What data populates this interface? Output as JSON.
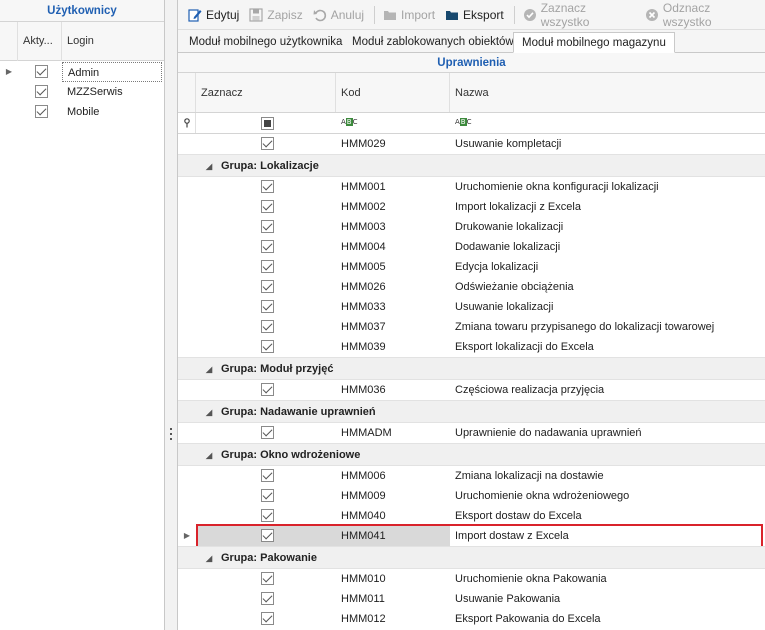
{
  "left_panel": {
    "title": "Użytkownicy",
    "columns": {
      "active": "Akty...",
      "login": "Login"
    },
    "users": [
      {
        "login": "Admin",
        "active": true,
        "focused": true
      },
      {
        "login": "MZZSerwis",
        "active": true
      },
      {
        "login": "Mobile",
        "active": true
      }
    ]
  },
  "toolbar": {
    "edit_label": "Edytuj",
    "save_label": "Zapisz",
    "cancel_label": "Anuluj",
    "import_label": "Import",
    "export_label": "Eksport",
    "select_all_label": "Zaznacz wszystko",
    "deselect_all_label": "Odznacz wszystko"
  },
  "tabs": [
    {
      "label": "Moduł mobilnego użytkownika",
      "active": false
    },
    {
      "label": "Moduł zablokowanych obiektów",
      "active": false
    },
    {
      "label": "Moduł mobilnego magazynu",
      "active": true
    }
  ],
  "grid": {
    "title": "Uprawnienia",
    "columns": {
      "select": "Zaznacz",
      "code": "Kod",
      "name": "Nazwa"
    },
    "filter_icon": "pin-icon",
    "sections": [
      {
        "group": null,
        "rows": [
          {
            "code": "HMM029",
            "name": "Usuwanie kompletacji"
          }
        ]
      },
      {
        "group": "Grupa: Lokalizacje",
        "rows": [
          {
            "code": "HMM001",
            "name": "Uruchomienie okna konfiguracji lokalizacji"
          },
          {
            "code": "HMM002",
            "name": "Import lokalizacji z Excela"
          },
          {
            "code": "HMM003",
            "name": "Drukowanie lokalizacji"
          },
          {
            "code": "HMM004",
            "name": "Dodawanie lokalizacji"
          },
          {
            "code": "HMM005",
            "name": "Edycja lokalizacji"
          },
          {
            "code": "HMM026",
            "name": "Odświeżanie obciążenia"
          },
          {
            "code": "HMM033",
            "name": "Usuwanie lokalizacji"
          },
          {
            "code": "HMM037",
            "name": "Zmiana towaru przypisanego do lokalizacji towarowej"
          },
          {
            "code": "HMM039",
            "name": "Eksport lokalizacji do Excela"
          }
        ]
      },
      {
        "group": "Grupa: Moduł przyjęć",
        "rows": [
          {
            "code": "HMM036",
            "name": "Częściowa realizacja przyjęcia"
          }
        ]
      },
      {
        "group": "Grupa: Nadawanie uprawnień",
        "rows": [
          {
            "code": "HMMADM",
            "name": "Uprawnienie do nadawania uprawnień"
          }
        ]
      },
      {
        "group": "Grupa: Okno wdrożeniowe",
        "rows": [
          {
            "code": "HMM006",
            "name": "Zmiana lokalizacji na dostawie"
          },
          {
            "code": "HMM009",
            "name": "Uruchomienie okna wdrożeniowego"
          },
          {
            "code": "HMM040",
            "name": "Eksport dostaw do Excela"
          },
          {
            "code": "HMM041",
            "name": "Import dostaw z Excela",
            "highlighted": true
          }
        ]
      },
      {
        "group": "Grupa: Pakowanie",
        "rows": [
          {
            "code": "HMM010",
            "name": "Uruchomienie okna Pakowania"
          },
          {
            "code": "HMM011",
            "name": "Usuwanie Pakowania"
          },
          {
            "code": "HMM012",
            "name": "Eksport Pakowania do Excela"
          }
        ]
      }
    ]
  },
  "colors": {
    "accent": "#1f5fb2",
    "highlight_border": "#d9232b"
  }
}
